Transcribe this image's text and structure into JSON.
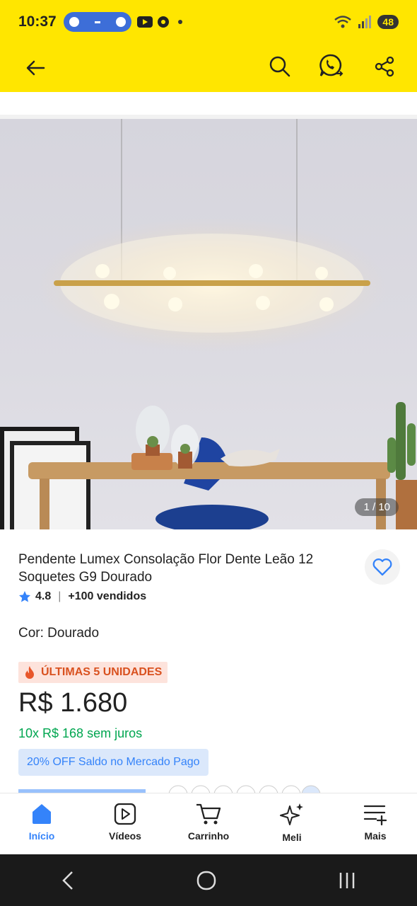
{
  "status": {
    "time": "10:37",
    "battery": "48"
  },
  "toolbar": {
    "back_icon": "arrow-left-icon",
    "search_icon": "search-icon",
    "whatsapp_icon": "whatsapp-icon",
    "share_icon": "share-icon"
  },
  "gallery": {
    "counter": "1 / 10"
  },
  "product": {
    "title": "Pendente Lumex Consolação Flor Dente Leão 12 Soquetes G9 Dourado",
    "rating": "4.8",
    "sold": "+100 vendidos",
    "color_label": "Cor: Dourado",
    "stock_badge": "ÚLTIMAS 5 UNIDADES",
    "price": "R$ 1.680",
    "installments": "10x R$ 168 sem juros",
    "promo": "20% OFF Saldo no Mercado Pago"
  },
  "nav": {
    "items": [
      {
        "label": "Início",
        "icon": "home-icon"
      },
      {
        "label": "Vídeos",
        "icon": "play-icon"
      },
      {
        "label": "Carrinho",
        "icon": "cart-icon"
      },
      {
        "label": "Meli",
        "icon": "sparkle-icon"
      },
      {
        "label": "Mais",
        "icon": "menu-plus-icon"
      }
    ]
  },
  "colors": {
    "brand_yellow": "#ffe600",
    "accent_blue": "#3483fa",
    "green": "#00a650",
    "badge_orange": "#d9511f"
  }
}
